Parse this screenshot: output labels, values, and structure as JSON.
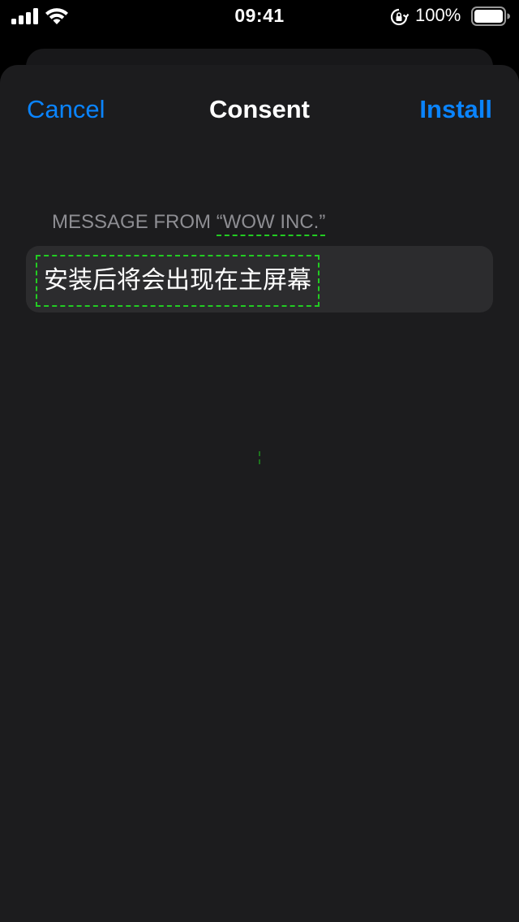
{
  "status_bar": {
    "time": "09:41",
    "battery_percent": "100%",
    "icons": [
      "cellular-signal-icon",
      "wifi-icon",
      "orientation-lock-icon",
      "battery-icon"
    ]
  },
  "nav": {
    "cancel_label": "Cancel",
    "title": "Consent",
    "install_label": "Install"
  },
  "message": {
    "header_prefix": "MESSAGE FROM ",
    "header_org": "“WOW INC.”",
    "text": "安装后将会出现在主屏幕"
  },
  "colors": {
    "accent": "#0a84ff",
    "sheet_background": "#1c1c1e",
    "card_background": "#2c2c2e",
    "secondary_text": "#8e8e93",
    "highlight_outline": "#22cc22"
  }
}
